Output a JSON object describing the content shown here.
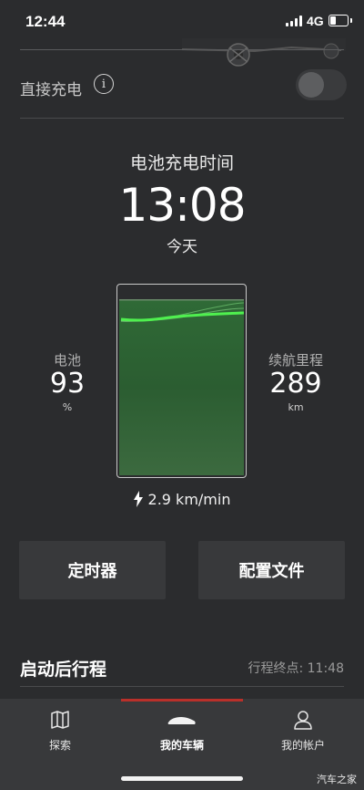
{
  "status_bar": {
    "time": "12:44",
    "network": "4G",
    "battery_level": 0.35
  },
  "direct_charge": {
    "label": "直接充电",
    "info_icon": "i",
    "enabled": false
  },
  "charging": {
    "title": "电池充电时间",
    "time": "13:08",
    "day": "今天"
  },
  "battery": {
    "label": "电池",
    "value": "93",
    "unit": "%"
  },
  "range": {
    "label": "续航里程",
    "value": "289",
    "unit": "km"
  },
  "charge_rate": "2.9 km/min",
  "buttons": {
    "timer": "定时器",
    "profiles": "配置文件"
  },
  "trip": {
    "title": "启动后行程",
    "destination": "行程终点: 11:48"
  },
  "tabs": [
    {
      "icon": "map-icon",
      "label": "探索",
      "active": false
    },
    {
      "icon": "car-icon",
      "label": "我的车辆",
      "active": true
    },
    {
      "icon": "account-icon",
      "label": "我的帐户",
      "active": false
    }
  ],
  "watermark": "汽车之家",
  "colors": {
    "accent_red": "#b9302a",
    "charge_green": "#3fcf3f",
    "background": "#2b2c2e"
  }
}
